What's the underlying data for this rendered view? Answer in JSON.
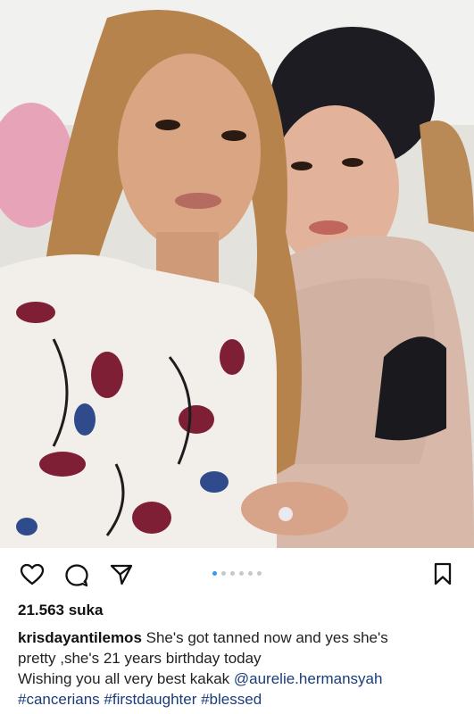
{
  "post": {
    "image": {
      "description": "",
      "pagination_count": 6,
      "pagination_active": 0
    },
    "likes": "21.563 suka",
    "caption": {
      "username": "krisdayantilemos",
      "line1_text": " She's got tanned now and yes she's",
      "line2_text": "pretty ,she's 21 years birthday today",
      "line3_text": "Wishing you all very best kakak ",
      "mention": "@aurelie.hermansyah",
      "hashtags": [
        "#cancerians",
        "#firstdaughter",
        "#blessed"
      ]
    }
  },
  "icons": {
    "like": "heart-icon",
    "comment": "comment-icon",
    "share": "share-icon",
    "save": "bookmark-icon"
  },
  "colors": {
    "pagination_active": "#3897f0",
    "pagination_inactive": "#c8c8c8",
    "link": "#1a3d7a"
  }
}
